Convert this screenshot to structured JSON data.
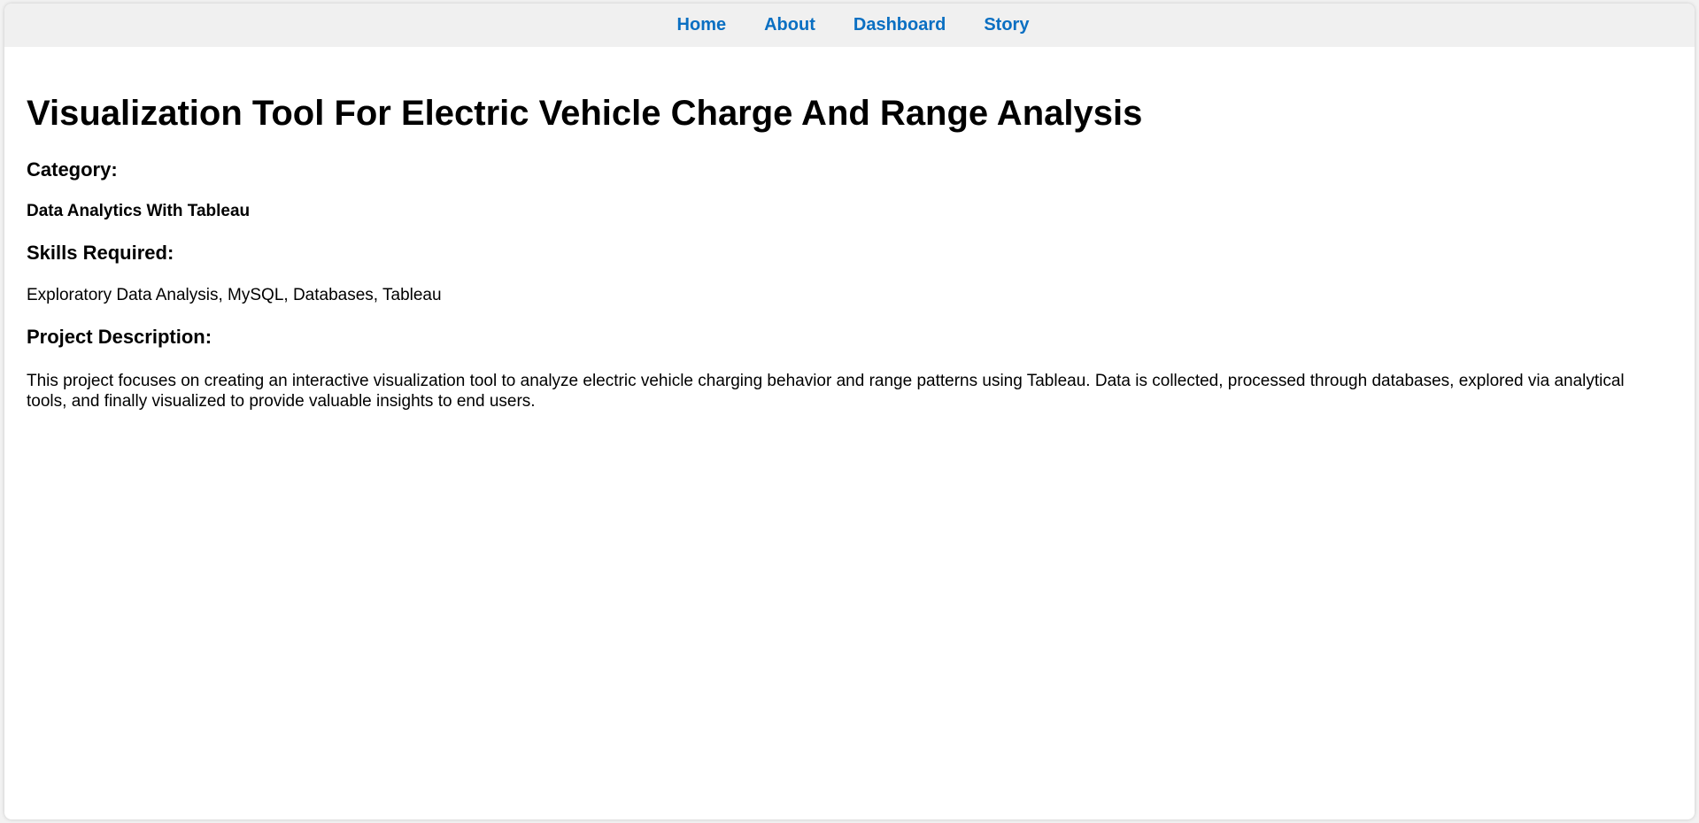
{
  "nav": {
    "items": [
      {
        "label": "Home"
      },
      {
        "label": "About"
      },
      {
        "label": "Dashboard"
      },
      {
        "label": "Story"
      }
    ]
  },
  "main": {
    "title": "Visualization Tool For Electric Vehicle Charge And Range Analysis",
    "category_heading": "Category:",
    "category_value": "Data Analytics With Tableau",
    "skills_heading": "Skills Required:",
    "skills_value": "Exploratory Data Analysis, MySQL, Databases, Tableau",
    "description_heading": "Project Description:",
    "description_text": "This project focuses on creating an interactive visualization tool to analyze electric vehicle charging behavior and range patterns using Tableau. Data is collected, processed through databases, explored via analytical tools, and finally visualized to provide valuable insights to end users."
  },
  "colors": {
    "nav_link": "#0a6fc2",
    "nav_background": "#f0f0f0",
    "page_background": "#ffffff",
    "text": "#000000"
  }
}
